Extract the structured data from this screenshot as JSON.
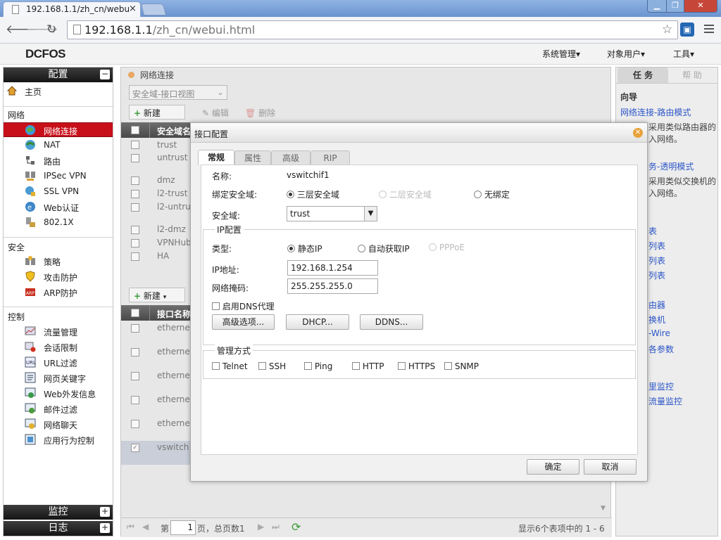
{
  "browser": {
    "tab_title": "192.168.1.1/zh_cn/webu",
    "tab_close": "×",
    "url_host": "192.168.1.1",
    "url_path": "/zh_cn/webui.html"
  },
  "app": {
    "logo": "DCFOS",
    "top_menu": [
      "系统管理▾",
      "对象用户▾",
      "工具▾"
    ]
  },
  "sidebar": {
    "config_header": "配置",
    "home": "主页",
    "groups": {
      "network": "网络",
      "security": "安全",
      "control": "控制"
    },
    "network_items": [
      "网络连接",
      "NAT",
      "路由",
      "IPSec VPN",
      "SSL VPN",
      "Web认证",
      "802.1X"
    ],
    "security_items": [
      "策略",
      "攻击防护",
      "ARP防护"
    ],
    "control_items": [
      "流量管理",
      "会话限制",
      "URL过滤",
      "网页关键字",
      "Web外发信息",
      "邮件过滤",
      "网络聊天",
      "应用行为控制"
    ],
    "monitor_header": "监控",
    "log_header": "日志",
    "selected": "网络连接"
  },
  "main": {
    "breadcrumb": "网络连接",
    "view_select": "安全域-接口视图",
    "toolbar1": {
      "new": "新建",
      "edit": "编辑",
      "delete": "删除"
    },
    "zone_header": "安全域名",
    "zones": [
      "trust",
      "untrust",
      "dmz",
      "l2-trust",
      "l2-untrust",
      "l2-dmz",
      "VPNHub",
      "HA"
    ],
    "toolbar2": {
      "new": "新建"
    },
    "iface_header": "接口名称",
    "interfaces": [
      "ethernet",
      "ethernet",
      "ethernet",
      "ethernet",
      "ethernet",
      "vswitch"
    ],
    "pager": {
      "page_prefix": "第",
      "page_num": "1",
      "page_suffix": "页，总页数1",
      "summary": "显示6个表项中的 1 - 6"
    }
  },
  "right_panel": {
    "tab_tasks": "任 务",
    "tab_help": "帮 助",
    "guide_title": "向导",
    "link1": "网络连接-路由模式",
    "text1a": "采用类似路由器的",
    "text1b": "入网络。",
    "link2": "务-透明模式",
    "text2a": "采用类似交换机的",
    "text2b": "入网络。",
    "links": [
      "表",
      "列表",
      "列表",
      "列表",
      "由器",
      "换机",
      "-Wire",
      "各参数",
      "里监控",
      "流量监控"
    ]
  },
  "dialog": {
    "title": "接口配置",
    "tabs": [
      "常规",
      "属性",
      "高级",
      "RIP"
    ],
    "name_label": "名称:",
    "name_value": "vswitchif1",
    "bind_label": "绑定安全域:",
    "bind_options": [
      "三层安全域",
      "二层安全域",
      "无绑定"
    ],
    "zone_label": "安全域:",
    "zone_value": "trust",
    "ip_section": "IP配置",
    "type_label": "类型:",
    "type_options": [
      "静态IP",
      "自动获取IP",
      "PPPoE"
    ],
    "ip_label": "IP地址:",
    "ip_value": "192.168.1.254",
    "mask_label": "网络掩码:",
    "mask_value": "255.255.255.0",
    "dns_proxy": "启用DNS代理",
    "btn_advanced": "高级选项...",
    "btn_dhcp": "DHCP...",
    "btn_ddns": "DDNS...",
    "mgmt_section": "管理方式",
    "mgmt_options": [
      "Telnet",
      "SSH",
      "Ping",
      "HTTP",
      "HTTPS",
      "SNMP"
    ],
    "ok": "确定",
    "cancel": "取消"
  }
}
